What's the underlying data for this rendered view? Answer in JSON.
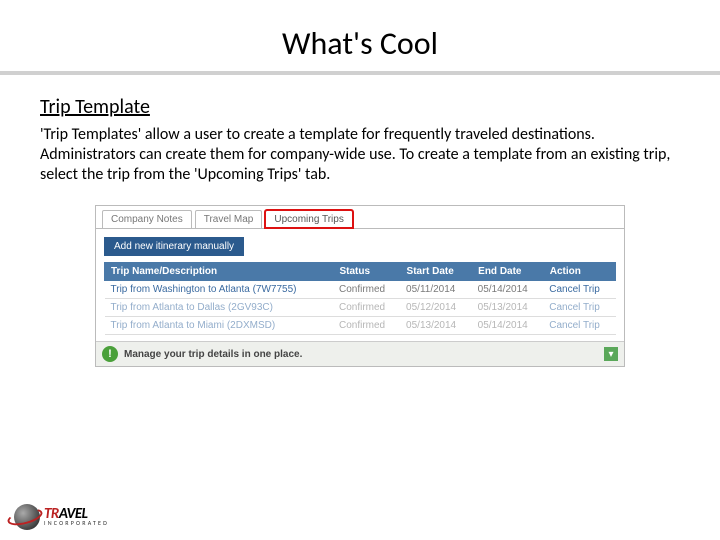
{
  "slide": {
    "title": "What's Cool",
    "section_heading": "Trip Template",
    "body": "'Trip Templates' allow a user to create a template for frequently traveled destinations.  Administrators can create them for company-wide use.  To create a template from an existing trip, select the trip from the 'Upcoming Trips' tab."
  },
  "tabs": {
    "t0": "Company Notes",
    "t1": "Travel Map",
    "t2": "Upcoming Trips"
  },
  "add_button": "Add new itinerary manually",
  "table": {
    "headers": {
      "name": "Trip Name/Description",
      "status": "Status",
      "start": "Start Date",
      "end": "End Date",
      "action": "Action"
    },
    "rows": [
      {
        "name": "Trip from Washington to Atlanta (7W7755)",
        "status": "Confirmed",
        "start": "05/11/2014",
        "end": "05/14/2014",
        "action": "Cancel Trip"
      },
      {
        "name": "Trip from Atlanta to Dallas (2GV93C)",
        "status": "Confirmed",
        "start": "05/12/2014",
        "end": "05/13/2014",
        "action": "Cancel Trip"
      },
      {
        "name": "Trip from Atlanta to Miami (2DXMSD)",
        "status": "Confirmed",
        "start": "05/13/2014",
        "end": "05/14/2014",
        "action": "Cancel Trip"
      }
    ]
  },
  "footer": {
    "text": "Manage your trip details in one place."
  },
  "logo": {
    "main1": "TR",
    "main2": "AVEL",
    "sub": "INCORPORATED"
  }
}
